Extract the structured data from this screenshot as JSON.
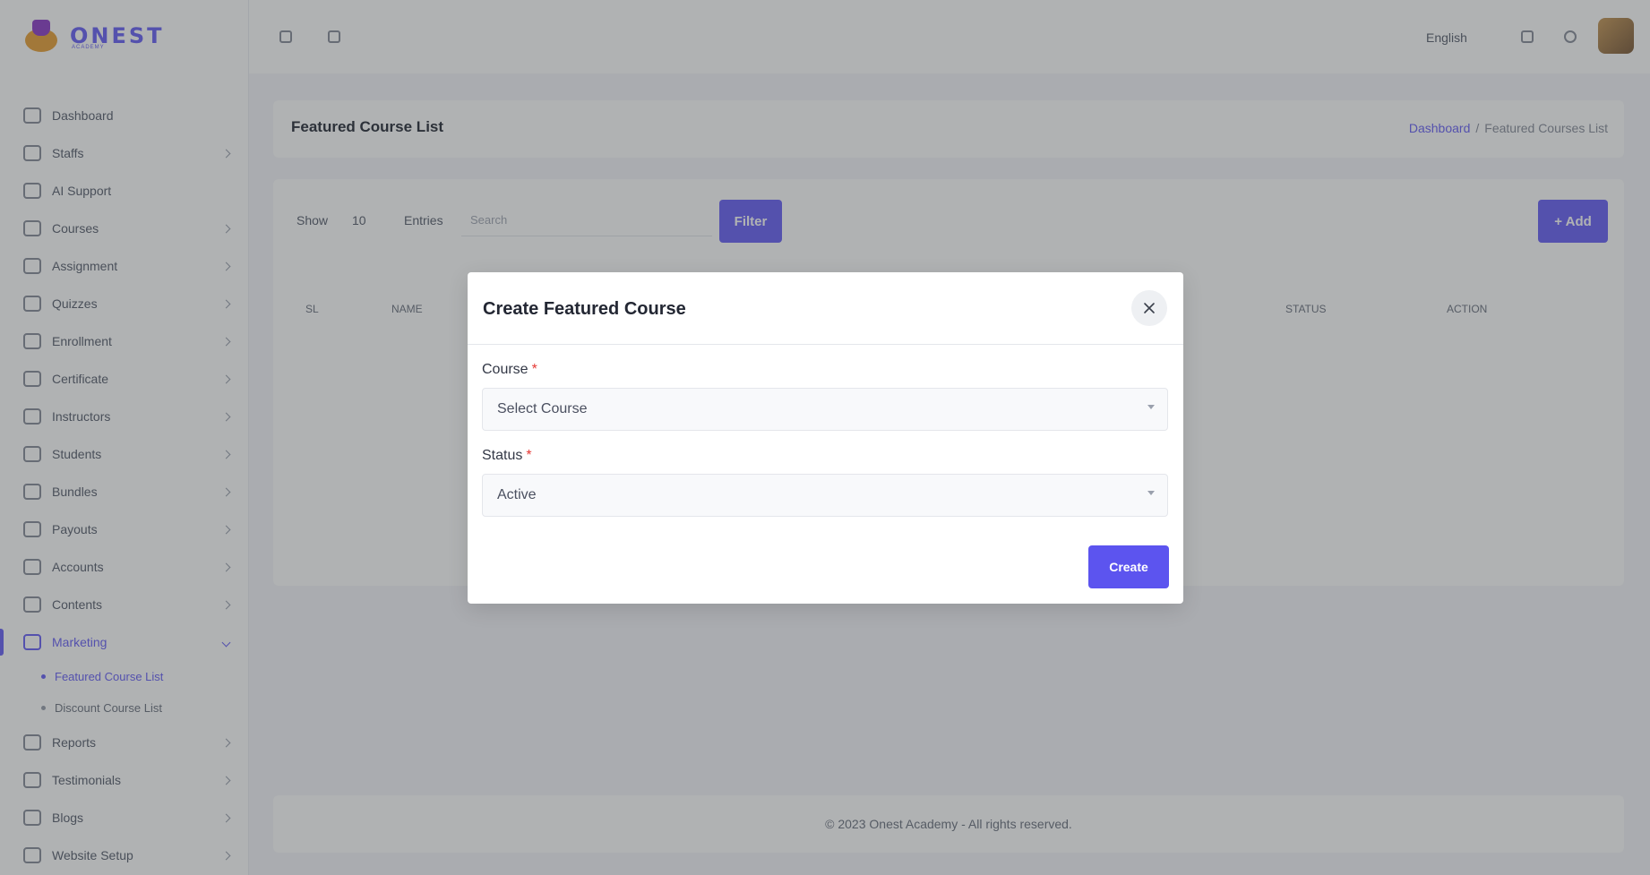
{
  "app": {
    "logo_text": "ONEST",
    "logo_subtext": "ACADEMY"
  },
  "sidebar": {
    "items": [
      {
        "label": "Dashboard",
        "icon": "home-icon",
        "has_children": false
      },
      {
        "label": "Staffs",
        "icon": "user-search-icon",
        "has_children": true
      },
      {
        "label": "AI Support",
        "icon": "chat-icon",
        "has_children": false
      },
      {
        "label": "Courses",
        "icon": "book-icon",
        "has_children": true
      },
      {
        "label": "Assignment",
        "icon": "clipboard-icon",
        "has_children": true
      },
      {
        "label": "Quizzes",
        "icon": "pencil-icon",
        "has_children": true
      },
      {
        "label": "Enrollment",
        "icon": "folder-icon",
        "has_children": true
      },
      {
        "label": "Certificate",
        "icon": "certificate-icon",
        "has_children": true
      },
      {
        "label": "Instructors",
        "icon": "id-card-icon",
        "has_children": true
      },
      {
        "label": "Students",
        "icon": "student-icon",
        "has_children": true
      },
      {
        "label": "Bundles",
        "icon": "package-icon",
        "has_children": true
      },
      {
        "label": "Payouts",
        "icon": "payout-icon",
        "has_children": true
      },
      {
        "label": "Accounts",
        "icon": "wallet-icon",
        "has_children": true
      },
      {
        "label": "Contents",
        "icon": "document-icon",
        "has_children": true
      },
      {
        "label": "Marketing",
        "icon": "megaphone-icon",
        "has_children": true,
        "active": true
      }
    ],
    "sub_items": [
      {
        "label": "Featured Course List",
        "active": true
      },
      {
        "label": "Discount Course List",
        "active": false
      }
    ],
    "items_after": [
      {
        "label": "Reports",
        "icon": "report-icon",
        "has_children": true
      },
      {
        "label": "Testimonials",
        "icon": "quote-icon",
        "has_children": true
      },
      {
        "label": "Blogs",
        "icon": "blog-icon",
        "has_children": true
      },
      {
        "label": "Website Setup",
        "icon": "settings-icon",
        "has_children": true
      }
    ]
  },
  "topbar": {
    "language": "English"
  },
  "page": {
    "title": "Featured Course List",
    "breadcrumb": [
      "Dashboard",
      "/",
      "Featured Courses List"
    ]
  },
  "table_controls": {
    "show_label": "Show",
    "show_value": "10",
    "entries_label": "Entries",
    "search_placeholder": "Search",
    "filter_label": "Filter",
    "add_label": "+ Add"
  },
  "table": {
    "columns": [
      "SL",
      "Name",
      "Status",
      "Action"
    ]
  },
  "footer": {
    "text": "© 2023 Onest Academy - All rights reserved."
  },
  "modal": {
    "title": "Create Featured Course",
    "fields": [
      {
        "label": "Course",
        "required_mark": "*",
        "value": "Select Course"
      },
      {
        "label": "Status",
        "required_mark": "*",
        "value": "Active"
      }
    ],
    "submit_label": "Create"
  },
  "colors": {
    "accent": "#5c54ef",
    "required": "#e53935",
    "overlay": "#303436"
  }
}
